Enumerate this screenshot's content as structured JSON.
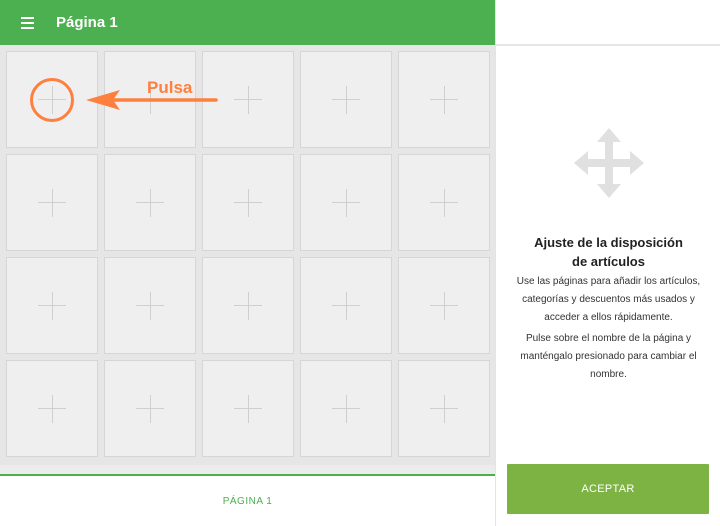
{
  "header": {
    "menu_icon": "hamburger-menu-icon",
    "title": "Página 1"
  },
  "grid": {
    "rows": 4,
    "columns": 5,
    "tile_icon": "plus-icon"
  },
  "annotation": {
    "label": "Pulsa",
    "color": "#ff7f3f"
  },
  "tabs": [
    {
      "label": "PÁGINA 1",
      "active": true
    }
  ],
  "info_panel": {
    "icon": "move-arrows-icon",
    "title_line1": "Ajuste de la disposición",
    "title_line2": "de artículos",
    "paragraph1": "Use las páginas para añadir los artículos, categorías y descuentos más usados y acceder a ellos rápidamente.",
    "paragraph2": "Pulse sobre el nombre de la página y manténgalo presionado para cambiar el nombre.",
    "accept_label": "ACEPTAR"
  },
  "colors": {
    "primary": "#4caf50",
    "accept": "#7cb342",
    "annotation": "#ff7f3f"
  }
}
